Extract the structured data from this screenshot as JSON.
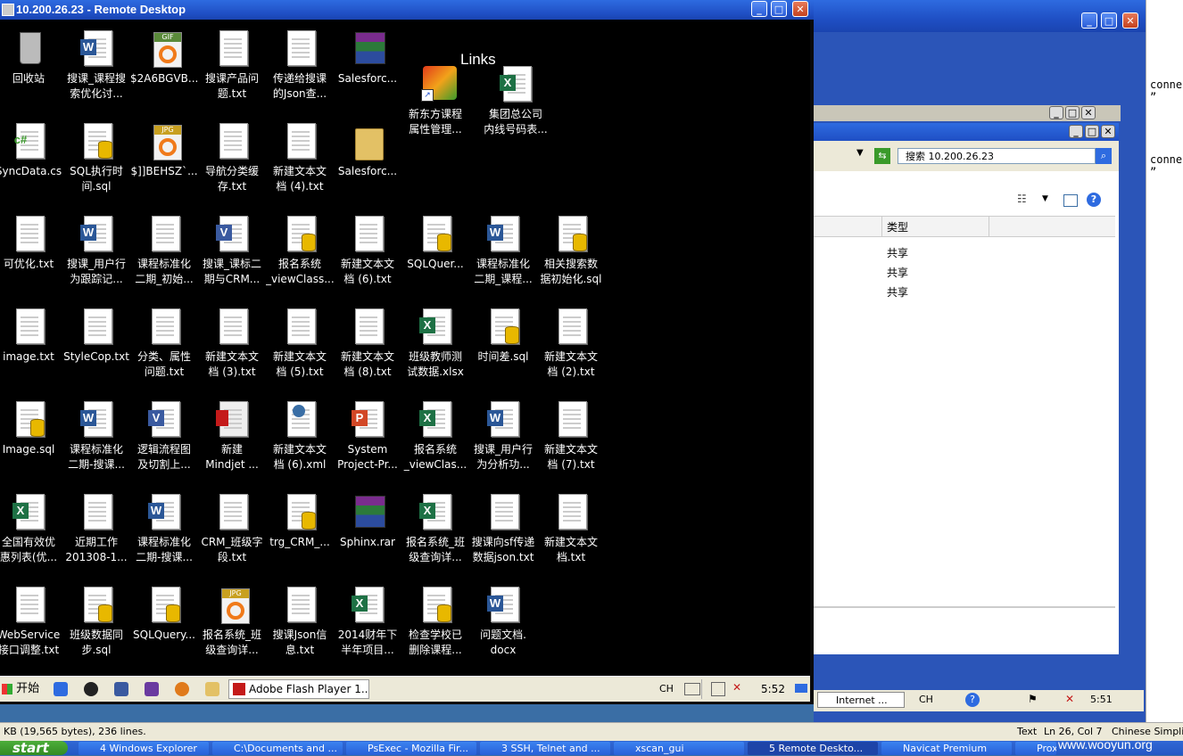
{
  "rdp_window": {
    "title": "10.200.26.23 - Remote Desktop"
  },
  "links_title": "Links",
  "desktop_icons": [
    {
      "label": "回收站",
      "kind": "bin"
    },
    {
      "label": "搜课_课程搜\n索优化讨...",
      "kind": "word"
    },
    {
      "label": "$2A6BGVB...",
      "kind": "gif"
    },
    {
      "label": "搜课产品问\n题.txt",
      "kind": "txt"
    },
    {
      "label": "传递给搜课\n的Json查...",
      "kind": "txt"
    },
    {
      "label": "Salesforc...",
      "kind": "rar"
    },
    {
      "label": "SyncData.cs",
      "kind": "cs"
    },
    {
      "label": "SQL执行时\n间.sql",
      "kind": "sql"
    },
    {
      "label": "$]]BEHSZ`...",
      "kind": "jpg"
    },
    {
      "label": "导航分类缓\n存.txt",
      "kind": "txt"
    },
    {
      "label": "新建文本文\n档 (4).txt",
      "kind": "txt"
    },
    {
      "label": "Salesforc...",
      "kind": "folder"
    },
    {
      "label": "新东方课程\n属性管理...",
      "kind": "shortcut"
    },
    {
      "label": "集团总公司\n内线号码表...",
      "kind": "excel"
    },
    {
      "label": "可优化.txt",
      "kind": "txt"
    },
    {
      "label": "搜课_用户行\n为跟踪记...",
      "kind": "word"
    },
    {
      "label": "课程标准化\n二期_初始...",
      "kind": "txt"
    },
    {
      "label": "搜课_课标二\n期与CRM...",
      "kind": "visio"
    },
    {
      "label": "报名系统\n_viewClass...",
      "kind": "sql"
    },
    {
      "label": "新建文本文\n档 (6).txt",
      "kind": "txt"
    },
    {
      "label": "SQLQuer...",
      "kind": "sql"
    },
    {
      "label": "课程标准化\n二期_课程...",
      "kind": "word"
    },
    {
      "label": "相关搜索数\n据初始化.sql",
      "kind": "sql"
    },
    {
      "label": "image.txt",
      "kind": "txt"
    },
    {
      "label": "StyleCop.txt",
      "kind": "txt"
    },
    {
      "label": "分类、属性\n问题.txt",
      "kind": "txt"
    },
    {
      "label": "新建文本文\n档 (3).txt",
      "kind": "txt"
    },
    {
      "label": "新建文本文\n档 (5).txt",
      "kind": "txt"
    },
    {
      "label": "新建文本文\n档 (8).txt",
      "kind": "txt"
    },
    {
      "label": "班级教师测\n试数据.xlsx",
      "kind": "excel"
    },
    {
      "label": "时间差.sql",
      "kind": "sql"
    },
    {
      "label": "新建文本文\n档 (2).txt",
      "kind": "txt"
    },
    {
      "label": "Image.sql",
      "kind": "sql"
    },
    {
      "label": "课程标准化\n二期-搜课...",
      "kind": "word"
    },
    {
      "label": "逻辑流程图\n及切割上...",
      "kind": "visio"
    },
    {
      "label": "新建\nMindjet ...",
      "kind": "mindjet"
    },
    {
      "label": "新建文本文\n档 (6).xml",
      "kind": "xml"
    },
    {
      "label": "System\nProject-Pr...",
      "kind": "ppt"
    },
    {
      "label": "报名系统\n_viewClas...",
      "kind": "excel"
    },
    {
      "label": "搜课_用户行\n为分析功...",
      "kind": "word"
    },
    {
      "label": "新建文本文\n档 (7).txt",
      "kind": "txt"
    },
    {
      "label": "全国有效优\n惠列表(优...",
      "kind": "excel"
    },
    {
      "label": "近期工作\n201308-1...",
      "kind": "txt"
    },
    {
      "label": "课程标准化\n二期-搜课...",
      "kind": "word"
    },
    {
      "label": "CRM_班级字\n段.txt",
      "kind": "txt"
    },
    {
      "label": "trg_CRM_...",
      "kind": "sql"
    },
    {
      "label": "Sphinx.rar",
      "kind": "rar"
    },
    {
      "label": "报名系统_班\n级查询详...",
      "kind": "excel"
    },
    {
      "label": "搜课向sf传递\n数据json.txt",
      "kind": "txt"
    },
    {
      "label": "新建文本文\n档.txt",
      "kind": "txt"
    },
    {
      "label": "WebService\n接口调整.txt",
      "kind": "txt"
    },
    {
      "label": "班级数据同\n步.sql",
      "kind": "sql"
    },
    {
      "label": "SQLQuery...",
      "kind": "sql"
    },
    {
      "label": "报名系统_班\n级查询详...",
      "kind": "jpg"
    },
    {
      "label": "搜课Json信\n息.txt",
      "kind": "txt"
    },
    {
      "label": "2014财年下\n半年项目...",
      "kind": "excel"
    },
    {
      "label": "检查学校已\n删除课程...",
      "kind": "sql"
    },
    {
      "label": "问题文档.\ndocx",
      "kind": "word"
    }
  ],
  "rdp_taskbar": {
    "start": "开始",
    "flash_button": "Adobe Flash Player 1...",
    "lang": "CH",
    "time": "5:52"
  },
  "explorer": {
    "search_placeholder": "搜索 10.200.26.23",
    "column_type": "类型",
    "rows": [
      "共享",
      "共享",
      "共享"
    ]
  },
  "code_lines": [
    "conne",
    "”",
    "conne",
    "”"
  ],
  "host_tray": {
    "internet_label": "Internet ...",
    "lang": "CH",
    "time": "5:51"
  },
  "editor_status": {
    "left": "KB (19,565 bytes), 236 lines.",
    "type": "Text",
    "position": "Ln 26, Col 7",
    "encoding": "Chinese Simplifie"
  },
  "host_taskbar": {
    "start": "start",
    "items": [
      "4 Windows Explorer",
      "C:\\Documents and ...",
      "PsExec - Mozilla Fir...",
      "3 SSH, Telnet and ...",
      "xscan_gui",
      "5 Remote Deskto...",
      "Navicat Premium",
      "Proxifier"
    ]
  },
  "watermark": "www.wooyun.org"
}
